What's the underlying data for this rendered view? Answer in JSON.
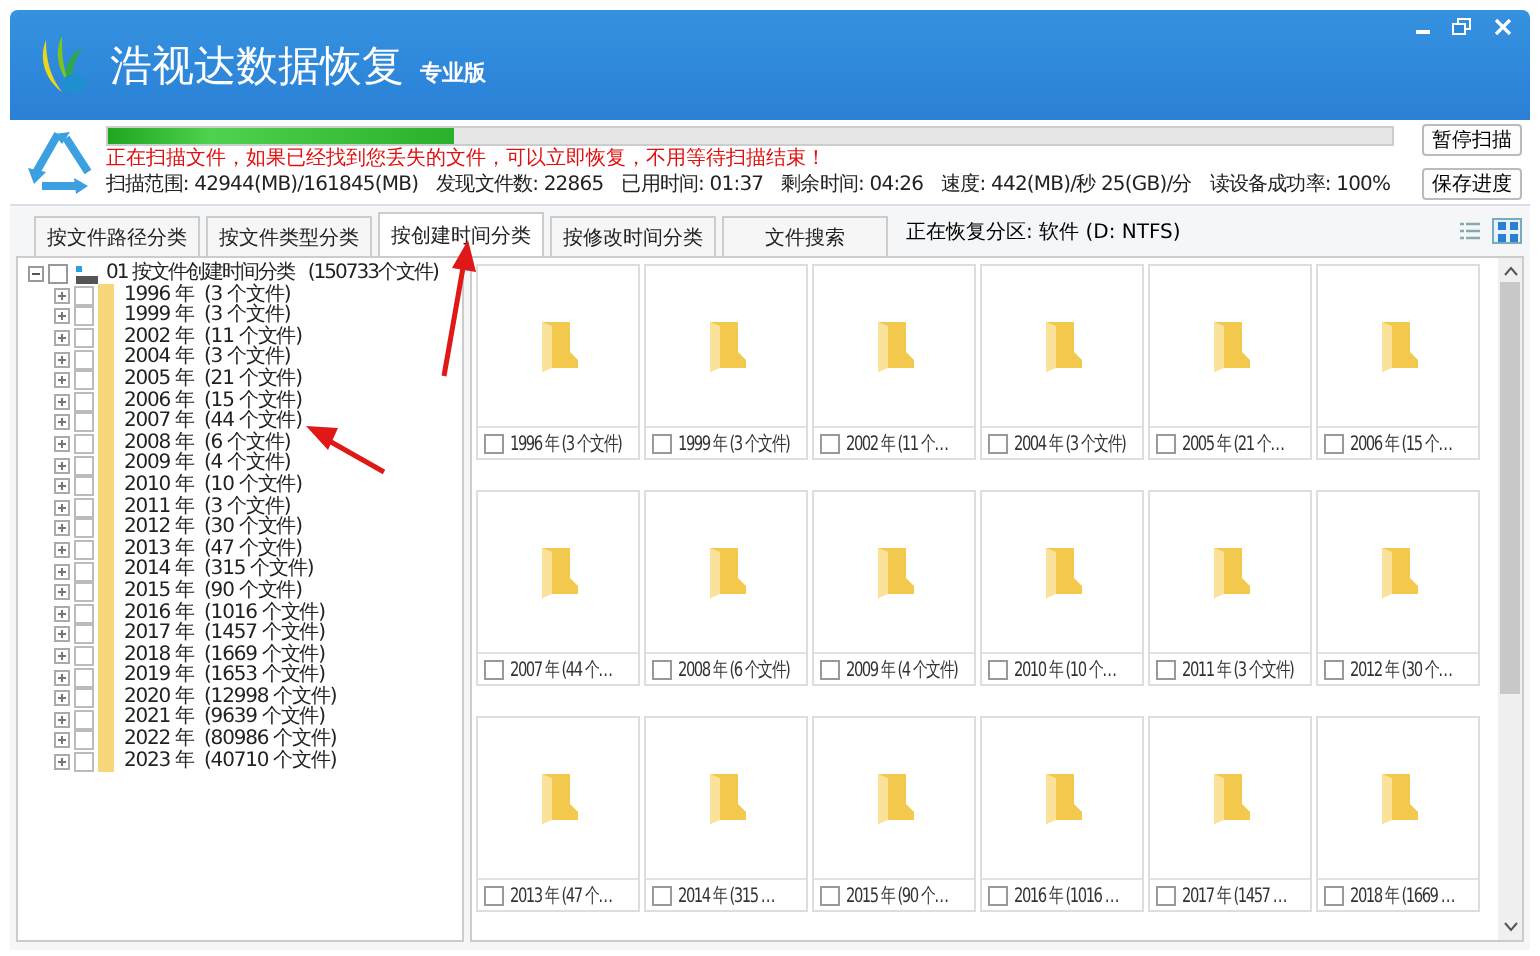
{
  "window": {
    "title": "浩视达数据恢复",
    "edition": "专业版"
  },
  "scan": {
    "level": 0.27,
    "message": "正在扫描文件，如果已经找到您丢失的文件，可以立即恢复，不用等待扫描结束！",
    "stats": [
      {
        "label": "扫描范围:",
        "value": "42944(MB)/161845(MB)"
      },
      {
        "label": "发现文件数:",
        "value": "22865"
      },
      {
        "label": "已用时间:",
        "value": "01:37"
      },
      {
        "label": "剩余时间:",
        "value": "04:26"
      },
      {
        "label": "速度:",
        "value": "442(MB)/秒  25(GB)/分"
      },
      {
        "label": "读设备成功率:",
        "value": "100%"
      }
    ],
    "buttons": [
      "暂停扫描",
      "保存进度"
    ]
  },
  "tabs": [
    {
      "label": "按文件路径分类",
      "selected": false
    },
    {
      "label": "按文件类型分类",
      "selected": false
    },
    {
      "label": "按创建时间分类",
      "selected": true
    },
    {
      "label": "按修改时间分类",
      "selected": false
    },
    {
      "label": "文件搜索",
      "selected": false
    }
  ],
  "partition": "正在恢复分区: 软件 (D: NTFS)",
  "view_modes": [
    {
      "kind": "list",
      "selected": false
    },
    {
      "kind": "grid",
      "selected": true
    }
  ],
  "tree": {
    "index": "01",
    "label": "按文件创建时间分类",
    "count": "(150733个文件)",
    "expanded": true,
    "checked": false,
    "children": [
      {
        "label": "1996 年",
        "count": "(3 个文件)",
        "expanded": false,
        "checked": false
      },
      {
        "label": "1999 年",
        "count": "(3 个文件)",
        "expanded": false,
        "checked": false
      },
      {
        "label": "2002 年",
        "count": "(11 个文件)",
        "expanded": false,
        "checked": false
      },
      {
        "label": "2004 年",
        "count": "(3 个文件)",
        "expanded": false,
        "checked": false
      },
      {
        "label": "2005 年",
        "count": "(21 个文件)",
        "expanded": false,
        "checked": false
      },
      {
        "label": "2006 年",
        "count": "(15 个文件)",
        "expanded": false,
        "checked": false
      },
      {
        "label": "2007 年",
        "count": "(44 个文件)",
        "expanded": false,
        "checked": false
      },
      {
        "label": "2008 年",
        "count": "(6 个文件)",
        "expanded": false,
        "checked": false
      },
      {
        "label": "2009 年",
        "count": "(4 个文件)",
        "expanded": false,
        "checked": false
      },
      {
        "label": "2010 年",
        "count": "(10 个文件)",
        "expanded": false,
        "checked": false
      },
      {
        "label": "2011 年",
        "count": "(3 个文件)",
        "expanded": false,
        "checked": false
      },
      {
        "label": "2012 年",
        "count": "(30 个文件)",
        "expanded": false,
        "checked": false
      },
      {
        "label": "2013 年",
        "count": "(47 个文件)",
        "expanded": false,
        "checked": false
      },
      {
        "label": "2014 年",
        "count": "(315 个文件)",
        "expanded": false,
        "checked": false
      },
      {
        "label": "2015 年",
        "count": "(90 个文件)",
        "expanded": false,
        "checked": false
      },
      {
        "label": "2016 年",
        "count": "(1016 个文件)",
        "expanded": false,
        "checked": false
      },
      {
        "label": "2017 年",
        "count": "(1457 个文件)",
        "expanded": false,
        "checked": false
      },
      {
        "label": "2018 年",
        "count": "(1669 个文件)",
        "expanded": false,
        "checked": false
      },
      {
        "label": "2019 年",
        "count": "(1653 个文件)",
        "expanded": false,
        "checked": false
      },
      {
        "label": "2020 年",
        "count": "(12998 个文件)",
        "expanded": false,
        "checked": false
      },
      {
        "label": "2021 年",
        "count": "(9639 个文件)",
        "expanded": false,
        "checked": false
      },
      {
        "label": "2022 年",
        "count": "(80986 个文件)",
        "expanded": false,
        "checked": false
      },
      {
        "label": "2023 年",
        "count": "(40710 个文件)",
        "expanded": false,
        "checked": false
      }
    ]
  },
  "tiles": [
    {
      "label": "1996 年 (3 个文件)",
      "checked": false
    },
    {
      "label": "1999 年 (3 个文件)",
      "checked": false
    },
    {
      "label": "2002 年 (11 个…",
      "checked": false
    },
    {
      "label": "2004 年 (3 个文件)",
      "checked": false
    },
    {
      "label": "2005 年 (21 个…",
      "checked": false
    },
    {
      "label": "2006 年 (15 个…",
      "checked": false
    },
    {
      "label": "2007 年 (44 个…",
      "checked": false
    },
    {
      "label": "2008 年 (6 个文件)",
      "checked": false
    },
    {
      "label": "2009 年 (4 个文件)",
      "checked": false
    },
    {
      "label": "2010 年 (10 个…",
      "checked": false
    },
    {
      "label": "2011 年 (3 个文件)",
      "checked": false
    },
    {
      "label": "2012 年 (30 个…",
      "checked": false
    },
    {
      "label": "2013 年 (47 个…",
      "checked": false
    },
    {
      "label": "2014 年 (315 …",
      "checked": false
    },
    {
      "label": "2015 年 (90 个…",
      "checked": false
    },
    {
      "label": "2016 年 (1016 …",
      "checked": false
    },
    {
      "label": "2017 年 (1457 …",
      "checked": false
    },
    {
      "label": "2018 年 (1669 …",
      "checked": false
    }
  ]
}
